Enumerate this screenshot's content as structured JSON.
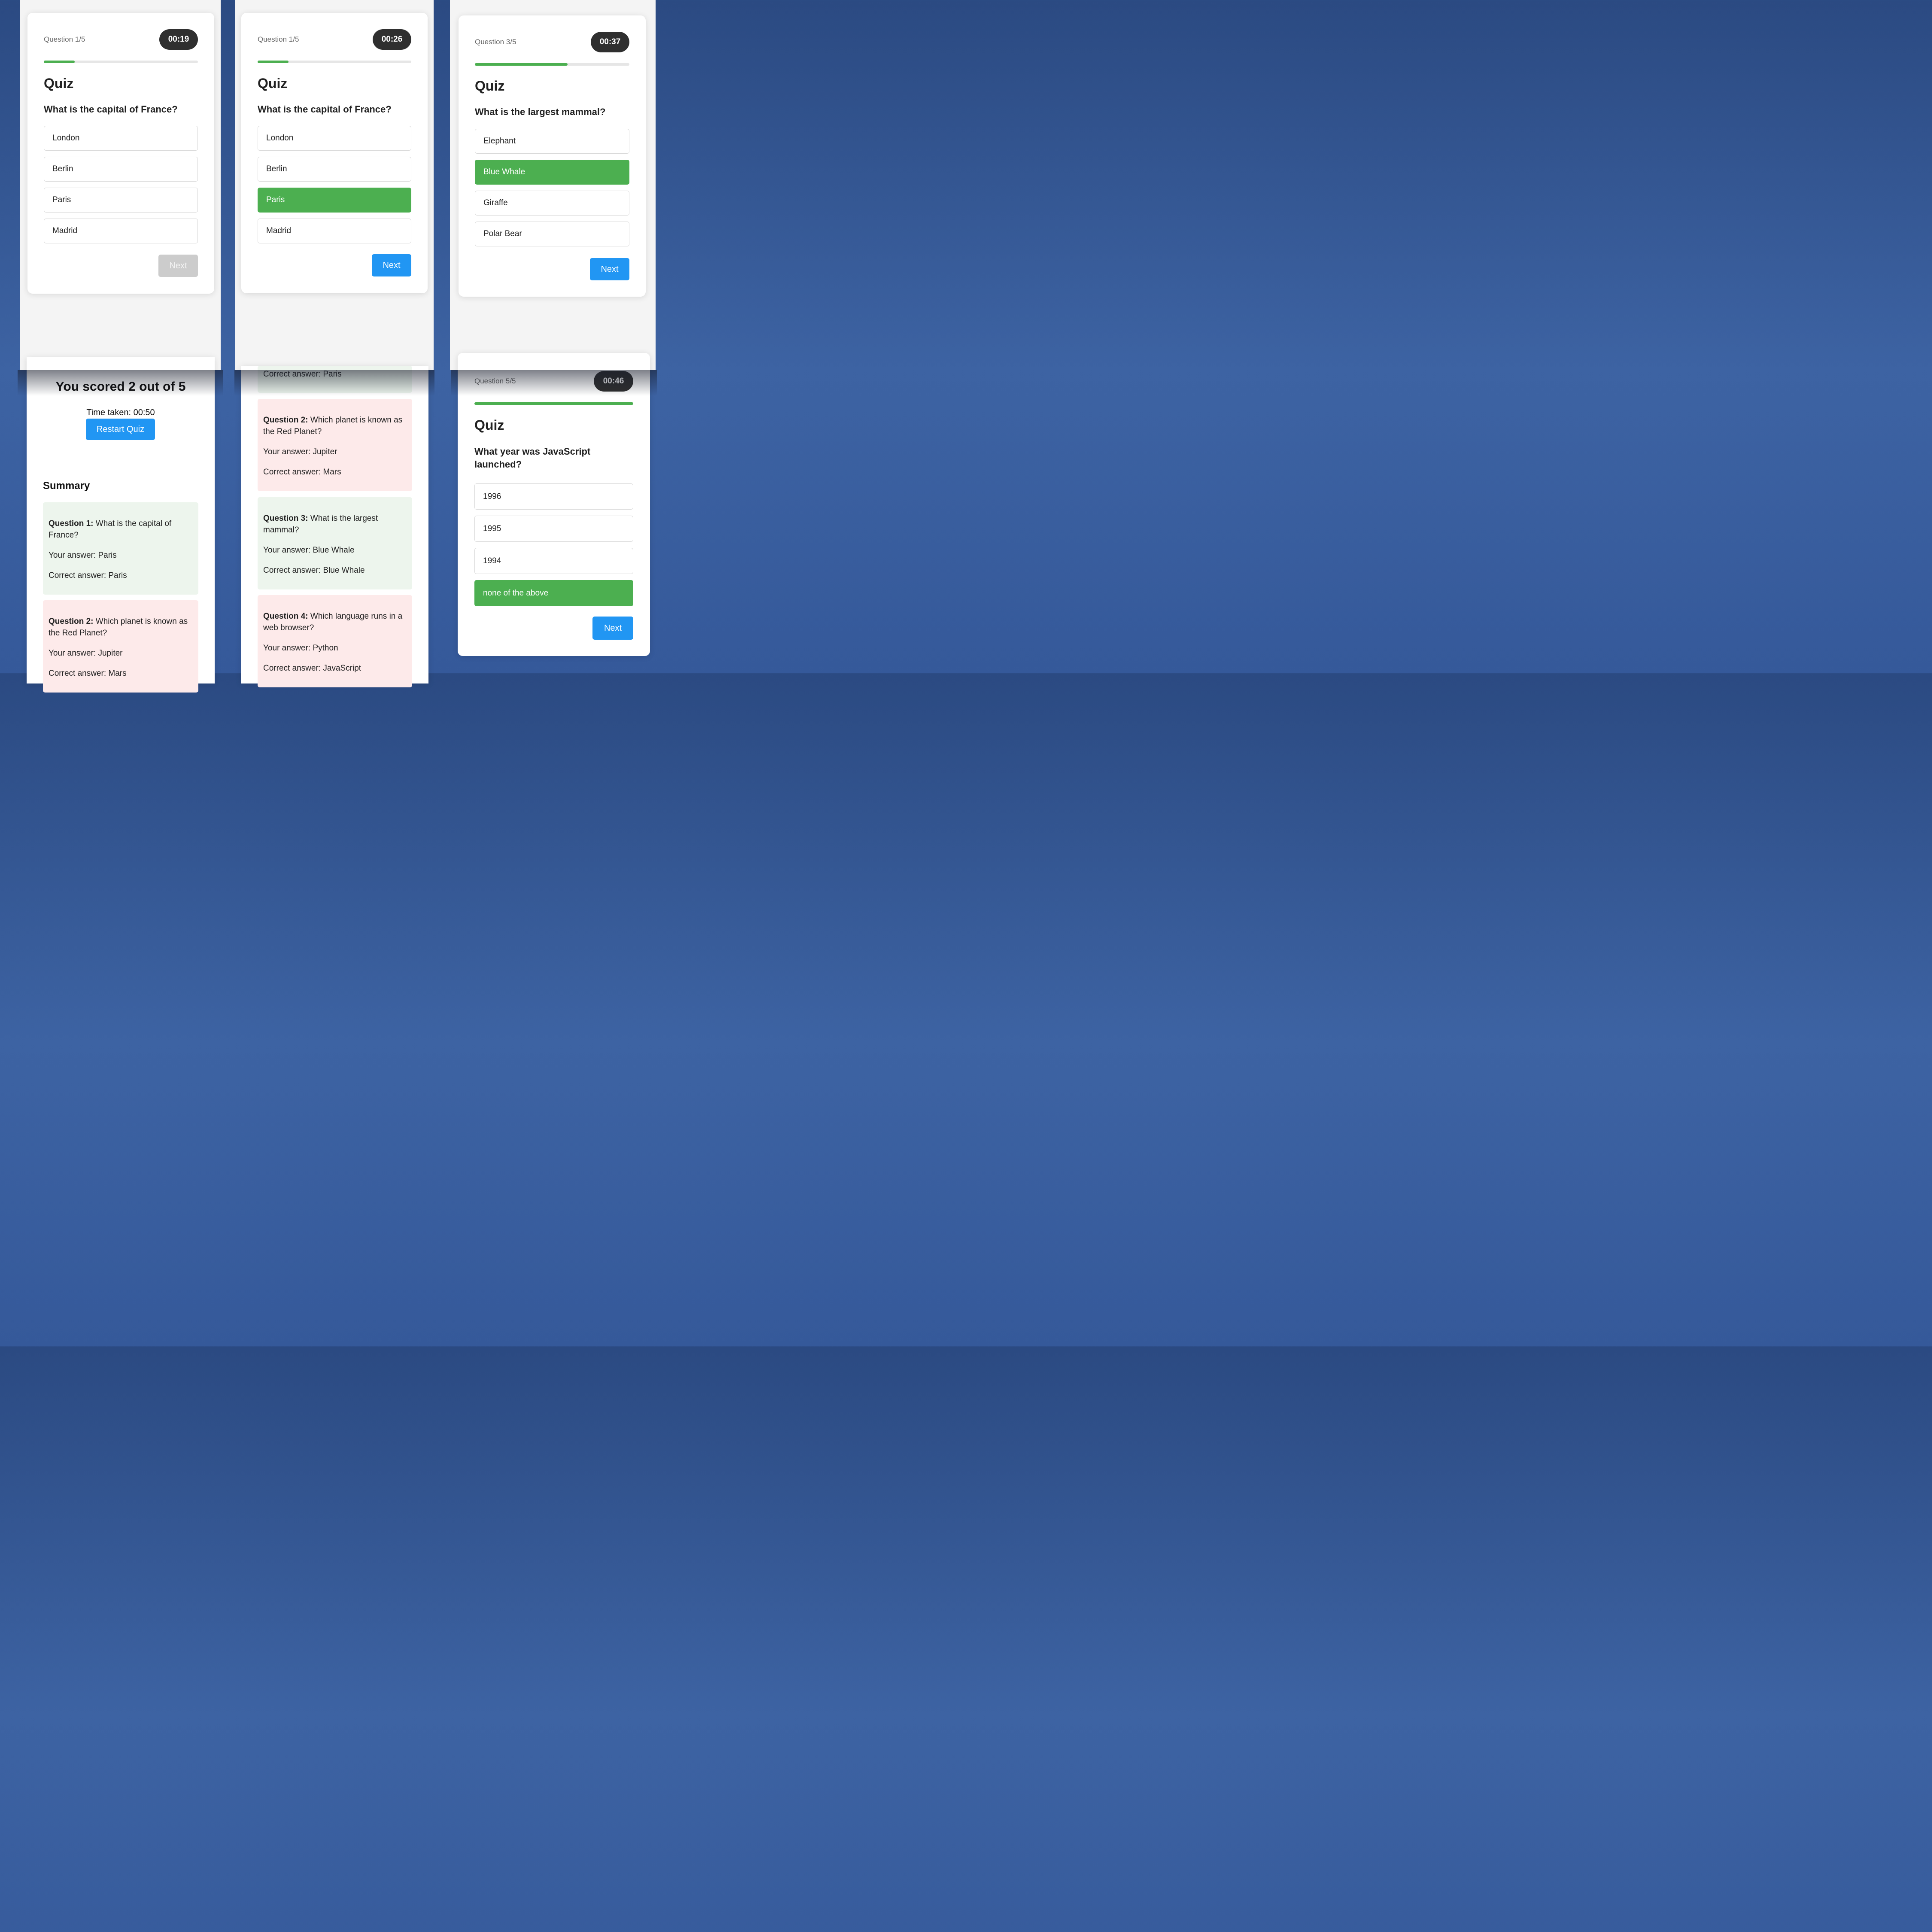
{
  "panel1": {
    "counter": "Question 1/5",
    "timer": "00:19",
    "progress": 0.2,
    "title": "Quiz",
    "question": "What is the capital of France?",
    "options": [
      "London",
      "Berlin",
      "Paris",
      "Madrid"
    ],
    "selected_index": null,
    "next_label": "Next",
    "next_enabled": false
  },
  "panel2": {
    "counter": "Question 1/5",
    "timer": "00:26",
    "progress": 0.2,
    "title": "Quiz",
    "question": "What is the capital of France?",
    "options": [
      "London",
      "Berlin",
      "Paris",
      "Madrid"
    ],
    "selected_index": 2,
    "next_label": "Next",
    "next_enabled": true
  },
  "panel3": {
    "counter": "Question 3/5",
    "timer": "00:37",
    "progress": 0.6,
    "title": "Quiz",
    "question": "What is the largest mammal?",
    "options": [
      "Elephant",
      "Blue Whale",
      "Giraffe",
      "Polar Bear"
    ],
    "selected_index": 1,
    "next_label": "Next",
    "next_enabled": true
  },
  "results": {
    "score": "You scored 2 out of 5",
    "time_taken": "Time taken: 00:50",
    "restart_label": "Restart Quiz",
    "summary_title": "Summary",
    "items": [
      {
        "label": "Question 1:",
        "question": "What is the capital of France?",
        "your_answer": "Your answer: Paris",
        "correct_answer": "Correct answer: Paris",
        "is_correct": true
      },
      {
        "label": "Question 2:",
        "question": "Which planet is known as the Red Planet?",
        "your_answer": "Your answer: Jupiter",
        "correct_answer": "Correct answer: Mars",
        "is_correct": false
      }
    ]
  },
  "results_scrolled": {
    "partial_correct_answer": "Correct answer: Paris",
    "items": [
      {
        "label": "Question 2:",
        "question": "Which planet is known as the Red Planet?",
        "your_answer": "Your answer: Jupiter",
        "correct_answer": "Correct answer: Mars",
        "is_correct": false
      },
      {
        "label": "Question 3:",
        "question": "What is the largest mammal?",
        "your_answer": "Your answer: Blue Whale",
        "correct_answer": "Correct answer: Blue Whale",
        "is_correct": true
      },
      {
        "label": "Question 4:",
        "question": "Which language runs in a web browser?",
        "your_answer": "Your answer: Python",
        "correct_answer": "Correct answer: JavaScript",
        "is_correct": false
      }
    ]
  },
  "panel6": {
    "counter": "Question 5/5",
    "timer": "00:46",
    "progress": 1.0,
    "title": "Quiz",
    "question": "What year was JavaScript launched?",
    "options": [
      "1996",
      "1995",
      "1994",
      "none of the above"
    ],
    "selected_index": 3,
    "next_label": "Next",
    "next_enabled": true
  },
  "colors": {
    "accent_blue": "#2196f3",
    "selected_green": "#4caf50",
    "correct_bg": "#edf5ed",
    "wrong_bg": "#fdeaea",
    "timer_bg": "#2f2f2f"
  }
}
